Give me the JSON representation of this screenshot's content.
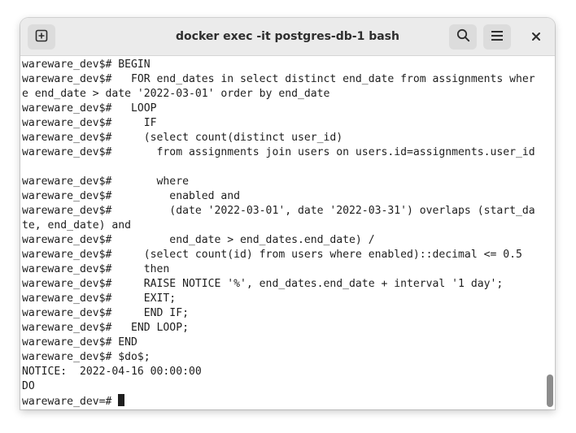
{
  "window": {
    "title": "docker exec -it postgres-db-1 bash"
  },
  "header": {
    "new_tab_icon": "plus-square-icon",
    "search_icon": "search-icon",
    "menu_icon": "hamburger-menu-icon",
    "close_icon": "close-icon"
  },
  "terminal": {
    "lines": [
      "wareware_dev$# BEGIN",
      "wareware_dev$#   FOR end_dates in select distinct end_date from assignments wher",
      "e end_date > date '2022-03-01' order by end_date",
      "wareware_dev$#   LOOP",
      "wareware_dev$#     IF",
      "wareware_dev$#     (select count(distinct user_id)",
      "wareware_dev$#       from assignments join users on users.id=assignments.user_id",
      "",
      "wareware_dev$#       where",
      "wareware_dev$#         enabled and",
      "wareware_dev$#         (date '2022-03-01', date '2022-03-31') overlaps (start_da",
      "te, end_date) and",
      "wareware_dev$#         end_date > end_dates.end_date) /",
      "wareware_dev$#     (select count(id) from users where enabled)::decimal <= 0.5",
      "wareware_dev$#     then",
      "wareware_dev$#     RAISE NOTICE '%', end_dates.end_date + interval '1 day';",
      "wareware_dev$#     EXIT;",
      "wareware_dev$#     END IF;",
      "wareware_dev$#   END LOOP;",
      "wareware_dev$# END",
      "wareware_dev$# $do$;",
      "NOTICE:  2022-04-16 00:00:00",
      "DO"
    ],
    "prompt": "wareware_dev=# "
  },
  "colors": {
    "headerbar": "#ebebeb",
    "button": "#dcdcdc",
    "text": "#1e1e1e",
    "background": "#ffffff",
    "scrollbar": "#8c8c8c"
  }
}
